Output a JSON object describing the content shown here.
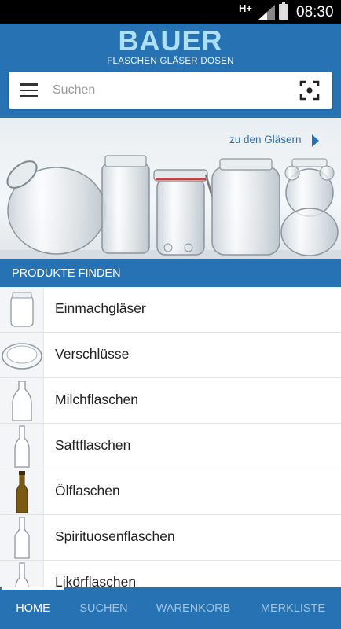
{
  "status_bar": {
    "network": "H+",
    "time": "08:30"
  },
  "header": {
    "logo_title": "BAUER",
    "logo_subtitle": "FLASCHEN GLÄSER DOSEN"
  },
  "search": {
    "placeholder": "Suchen",
    "menu_icon": "hamburger-menu-icon",
    "scan_icon": "scan-icon"
  },
  "banner": {
    "link_label": "zu den Gläsern",
    "arrow_icon": "arrow-right-icon"
  },
  "section": {
    "title": "PRODUKTE FINDEN"
  },
  "products": [
    {
      "label": "Einmachgläser",
      "thumb": "jar"
    },
    {
      "label": "Verschlüsse",
      "thumb": "lid"
    },
    {
      "label": "Milchflaschen",
      "thumb": "milk-bottle"
    },
    {
      "label": "Saftflaschen",
      "thumb": "juice-bottle"
    },
    {
      "label": "Ölflaschen",
      "thumb": "oil-bottle"
    },
    {
      "label": "Spirituosenflaschen",
      "thumb": "spirits-bottle"
    },
    {
      "label": "Likörflaschen",
      "thumb": "liqueur-bottle"
    }
  ],
  "bottom_nav": {
    "tabs": [
      "HOME",
      "SUCHEN",
      "WARENKORB",
      "MERKLISTE"
    ],
    "active": "HOME"
  },
  "colors": {
    "brand_blue": "#2672b3",
    "logo_light_blue": "#aee0f7",
    "oil_bottle_amber": "#7a5a12"
  }
}
